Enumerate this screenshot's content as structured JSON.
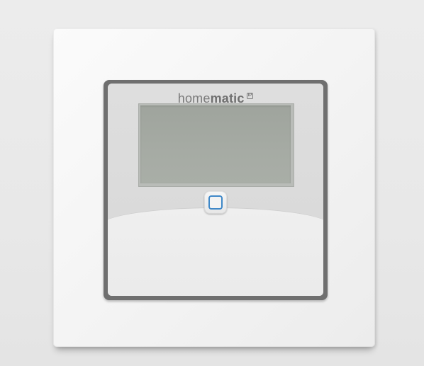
{
  "device": {
    "brand_light": "home",
    "brand_bold": "matic",
    "brand_badge": "IP",
    "colors": {
      "backdrop": "#e9e9e9",
      "frame": "#f5f5f5",
      "display": "#a4a9a2",
      "button_ring": "#3f88c8"
    },
    "icons": {
      "button": "rounded-square-icon"
    }
  }
}
